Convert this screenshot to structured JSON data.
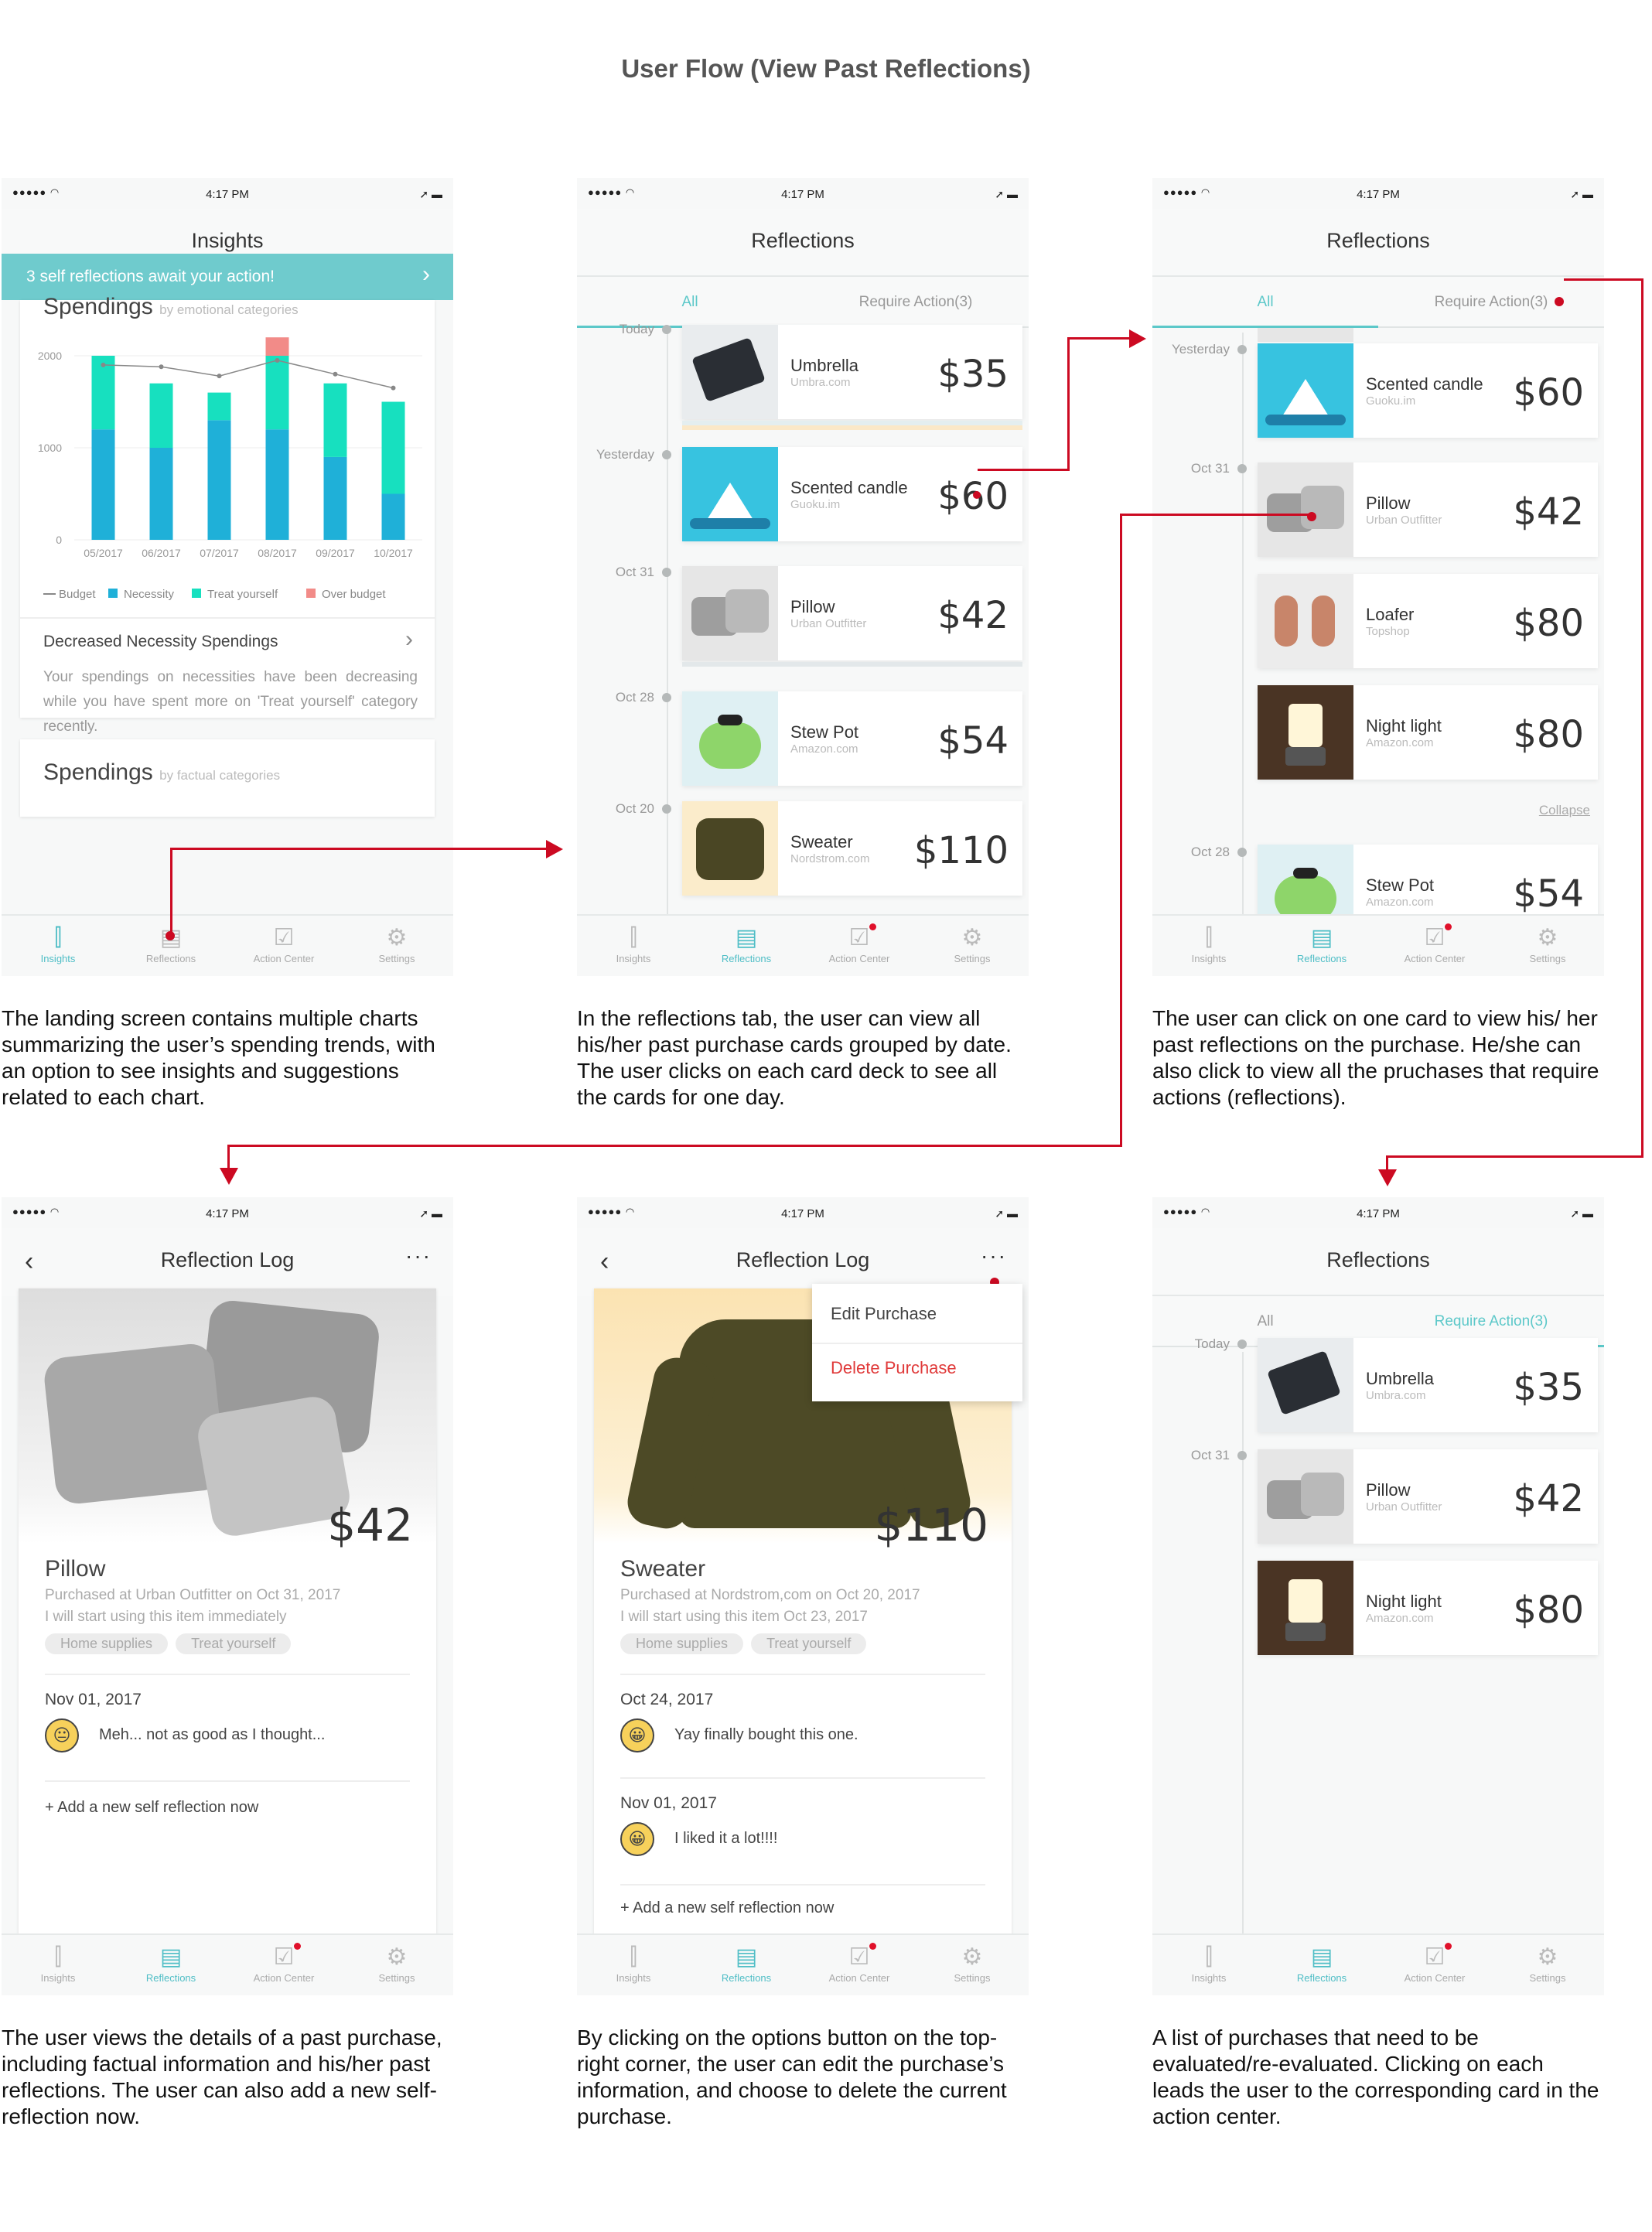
{
  "title": "User Flow (View Past Reflections)",
  "status_time": "4:17 PM",
  "nav": [
    "Insights",
    "Reflections",
    "Action Center",
    "Settings"
  ],
  "screen1": {
    "header": "Insights",
    "banner": "3 self reflections await your action!",
    "chart_title": "Spendings",
    "chart_sub": "by emotional categories",
    "insight_title": "Decreased Necessity Spendings",
    "insight_text": "Your spendings on necessities have been decreasing while you have spent more on 'Treat yourself' category recently.",
    "chart2_title": "Spendings",
    "chart2_sub": "by factual categories"
  },
  "chart_data": {
    "type": "bar",
    "categories": [
      "05/2017",
      "06/2017",
      "07/2017",
      "08/2017",
      "09/2017",
      "10/2017"
    ],
    "series": [
      {
        "name": "Necessity",
        "values": [
          1200,
          1000,
          1300,
          1200,
          900,
          500
        ]
      },
      {
        "name": "Treat yourself",
        "values": [
          800,
          700,
          300,
          800,
          800,
          1000
        ]
      },
      {
        "name": "Over budget",
        "values": [
          0,
          0,
          0,
          200,
          0,
          0
        ]
      },
      {
        "name": "Budget",
        "values": [
          1900,
          1880,
          1780,
          1950,
          1800,
          1650
        ]
      }
    ],
    "ylim": [
      0,
      2000
    ],
    "yticks": [
      "2000",
      "1000",
      "0"
    ],
    "legend": [
      "Budget",
      "Necessity",
      "Treat yourself",
      "Over budget"
    ],
    "colors": {
      "Necessity": "#1fb0d8",
      "Treat yourself": "#17e0bf",
      "Over budget": "#f28b88",
      "Budget": "#888888"
    }
  },
  "reflections_header": "Reflections",
  "tab_all": "All",
  "tab_require": "Require Action(3)",
  "screen2": {
    "dates": [
      "Today",
      "Yesterday",
      "Oct 31",
      "Oct 28",
      "Oct 20"
    ],
    "cards": [
      {
        "name": "Umbrella",
        "store": "Umbra.com",
        "price": "$35"
      },
      {
        "name": "Scented candle",
        "store": "Guoku.im",
        "price": "$60"
      },
      {
        "name": "Pillow",
        "store": "Urban Outfitter",
        "price": "$42"
      },
      {
        "name": "Stew Pot",
        "store": "Amazon.com",
        "price": "$54"
      },
      {
        "name": "Sweater",
        "store": "Nordstrom.com",
        "price": "$110"
      }
    ]
  },
  "screen3": {
    "dates": [
      "Yesterday",
      "Oct 31",
      "Oct 28"
    ],
    "cards": [
      {
        "name": "Scented candle",
        "store": "Guoku.im",
        "price": "$60"
      },
      {
        "name": "Pillow",
        "store": "Urban Outfitter",
        "price": "$42"
      },
      {
        "name": "Loafer",
        "store": "Topshop",
        "price": "$80"
      },
      {
        "name": "Night light",
        "store": "Amazon.com",
        "price": "$80"
      },
      {
        "name": "Stew Pot",
        "store": "Amazon.com",
        "price": "$54"
      }
    ],
    "collapse": "Collapse"
  },
  "screen4": {
    "header": "Reflection Log",
    "price": "$42",
    "name": "Pillow",
    "purchased": "Purchased at Urban Outfitter on Oct 31, 2017",
    "note": "I will start using this item immediately",
    "tags": [
      "Home supplies",
      "Treat yourself"
    ],
    "log_date": "Nov 01, 2017",
    "log_text": "Meh... not as good as I thought...",
    "add": "+ Add a new self reflection now"
  },
  "screen5": {
    "header": "Reflection Log",
    "menu_edit": "Edit Purchase",
    "menu_delete": "Delete Purchase",
    "price": "$110",
    "name": "Sweater",
    "purchased": "Purchased at Nordstrom,com on Oct 20, 2017",
    "note": "I will start using this item Oct 23, 2017",
    "tags": [
      "Home supplies",
      "Treat yourself"
    ],
    "log1_date": "Oct 24, 2017",
    "log1_text": "Yay finally bought this one.",
    "log2_date": "Nov 01, 2017",
    "log2_text": "I liked it a lot!!!!",
    "add": "+ Add a new self reflection now"
  },
  "screen6": {
    "dates": [
      "Today",
      "Oct 31"
    ],
    "cards": [
      {
        "name": "Umbrella",
        "store": "Umbra.com",
        "price": "$35"
      },
      {
        "name": "Pillow",
        "store": "Urban Outfitter",
        "price": "$42"
      },
      {
        "name": "Night light",
        "store": "Amazon.com",
        "price": "$80"
      }
    ]
  },
  "captions": [
    "The landing screen contains multiple charts summarizing the user’s spending trends, with an option to see insights and suggestions related to each chart.",
    "In the reflections tab, the user can view all his/her past purchase cards grouped by date. The user clicks on each card deck to see all the cards for one day.",
    "The user can click on one card to view his/ her past reflections on the purchase. He/she can also click to view all the pruchases that require actions (reflections).",
    "The user views the details of a past purchase, including factual information and his/her past reflections. The user can also add a new self-reflection now.",
    "By clicking on the options button on the top-right corner, the user can edit the purchase’s information, and choose to delete the current purchase.",
    "A list of purchases that need to be evaluated/re-evaluated. Clicking on each leads the user to the corresponding card in the action center."
  ]
}
